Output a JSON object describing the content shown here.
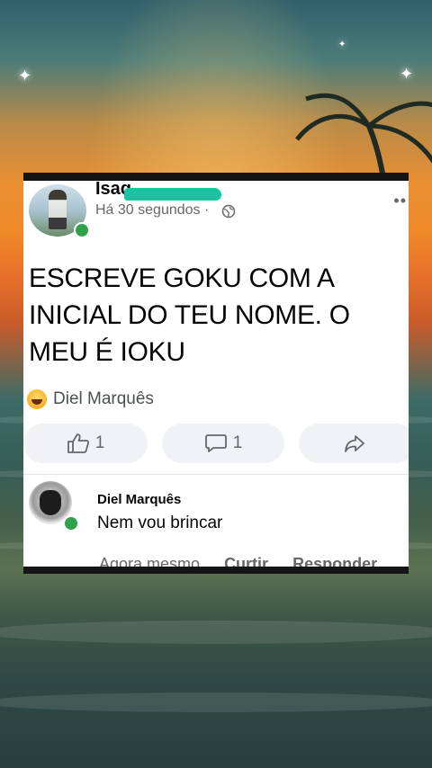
{
  "post": {
    "author": "Isaq",
    "time": "Há 30 segundos",
    "separator": "·",
    "globe_icon": "globe-icon",
    "text": "ESCREVE GOKU COM A INICIAL DO TEU NOME. O MEU É IOKU",
    "reaction_name": "Diel Marquês",
    "reaction_icon": "haha-emoji-icon"
  },
  "actions": {
    "like_count": "1",
    "comment_count": "1",
    "like_icon": "thumbs-up-icon",
    "comment_icon": "comment-bubble-icon",
    "share_icon": "share-arrow-icon"
  },
  "comment": {
    "author": "Diel Marquês",
    "text": "Nem vou brincar",
    "time": "Agora mesmo",
    "like_label": "Curtir",
    "reply_label": "Responder"
  },
  "colors": {
    "online": "#31a24c",
    "secondary_text": "#65676b",
    "button_bg": "#f0f2f5"
  }
}
